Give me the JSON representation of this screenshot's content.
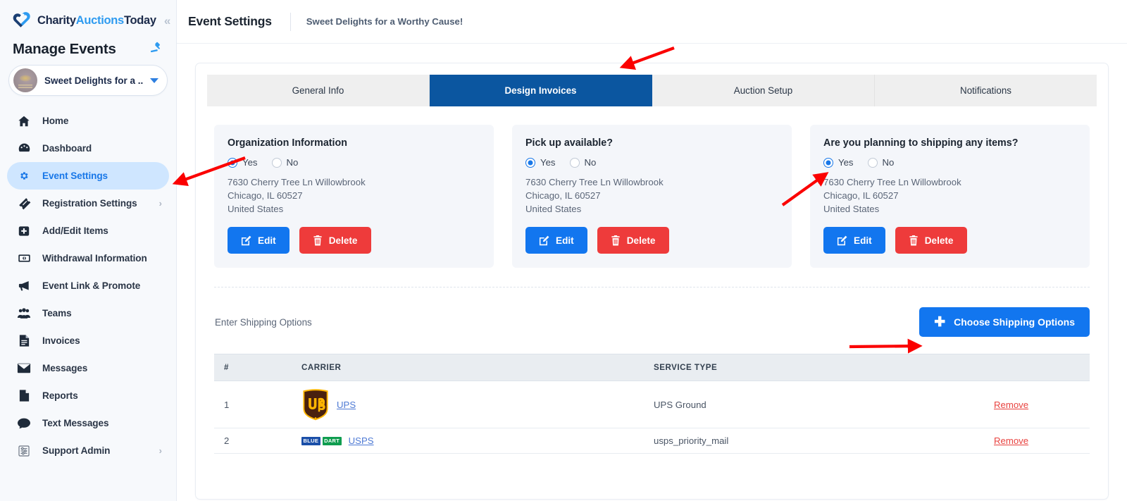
{
  "brand": {
    "name_part1": "Charity",
    "name_part2": "Auctions",
    "name_part3": "Today",
    "collapse_icon": "double-chevron-left-icon"
  },
  "sidebar": {
    "manage_title": "Manage Events",
    "gavel_icon": "gavel-icon",
    "event_selector": {
      "label": "Sweet Delights for a ...",
      "avatar": "event-avatar",
      "caret": "chevron-down-icon"
    },
    "items": [
      {
        "label": "Home",
        "icon": "home-icon",
        "active": false,
        "chevron": ""
      },
      {
        "label": "Dashboard",
        "icon": "dashboard-icon",
        "active": false,
        "chevron": ""
      },
      {
        "label": "Event Settings",
        "icon": "gear-icon",
        "active": true,
        "chevron": ""
      },
      {
        "label": "Registration Settings",
        "icon": "ticket-icon",
        "active": false,
        "chevron": "›"
      },
      {
        "label": "Add/Edit Items",
        "icon": "plus-square-icon",
        "active": false,
        "chevron": ""
      },
      {
        "label": "Withdrawal Information",
        "icon": "money-icon",
        "active": false,
        "chevron": ""
      },
      {
        "label": "Event Link & Promote",
        "icon": "megaphone-icon",
        "active": false,
        "chevron": ""
      },
      {
        "label": "Teams",
        "icon": "people-icon",
        "active": false,
        "chevron": ""
      },
      {
        "label": "Invoices",
        "icon": "invoice-icon",
        "active": false,
        "chevron": ""
      },
      {
        "label": "Messages",
        "icon": "envelope-icon",
        "active": false,
        "chevron": ""
      },
      {
        "label": "Reports",
        "icon": "document-icon",
        "active": false,
        "chevron": ""
      },
      {
        "label": "Text Messages",
        "icon": "chat-bubble-icon",
        "active": false,
        "chevron": ""
      },
      {
        "label": "Support Admin",
        "icon": "sliders-icon",
        "active": false,
        "chevron": "›"
      }
    ]
  },
  "header": {
    "title": "Event Settings",
    "event_name": "Sweet Delights for a Worthy Cause!"
  },
  "tabs": [
    {
      "label": "General Info",
      "active": false
    },
    {
      "label": "Design Invoices",
      "active": true
    },
    {
      "label": "Auction Setup",
      "active": false
    },
    {
      "label": "Notifications",
      "active": false
    }
  ],
  "cards": [
    {
      "title": "Organization Information",
      "yes_label": "Yes",
      "no_label": "No",
      "selected": "Yes",
      "address_line1": "7630 Cherry Tree Ln Willowbrook",
      "address_line2": "Chicago, IL 60527",
      "address_line3": "United States",
      "edit_label": "Edit",
      "delete_label": "Delete"
    },
    {
      "title": "Pick up available?",
      "yes_label": "Yes",
      "no_label": "No",
      "selected": "Yes",
      "address_line1": "7630 Cherry Tree Ln Willowbrook",
      "address_line2": "Chicago, IL 60527",
      "address_line3": "United States",
      "edit_label": "Edit",
      "delete_label": "Delete"
    },
    {
      "title": "Are you planning to shipping any items?",
      "yes_label": "Yes",
      "no_label": "No",
      "selected": "Yes",
      "address_line1": "7630 Cherry Tree Ln Willowbrook",
      "address_line2": "Chicago, IL 60527",
      "address_line3": "United States",
      "edit_label": "Edit",
      "delete_label": "Delete"
    }
  ],
  "shipping": {
    "section_label": "Enter Shipping Options",
    "choose_button": "Choose Shipping Options",
    "choose_button_icon": "plus-icon",
    "columns": [
      "#",
      "CARRIER",
      "SERVICE TYPE",
      ""
    ],
    "rows": [
      {
        "num": "1",
        "carrier_logo": "ups-logo",
        "carrier": "UPS",
        "service_type": "UPS Ground",
        "action": "Remove"
      },
      {
        "num": "2",
        "carrier_logo": "blue-dart-logo",
        "carrier": "USPS",
        "service_type": "usps_priority_mail",
        "action": "Remove"
      }
    ]
  },
  "colors": {
    "accent_blue": "#1276ef",
    "tab_active": "#0b56a0",
    "danger_red": "#ee3b3b",
    "annotation_red": "#fb0000",
    "sidebar_bg": "#f7f9fc",
    "sidebar_active": "#cfe6ff",
    "card_bg": "#f4f6fa"
  }
}
